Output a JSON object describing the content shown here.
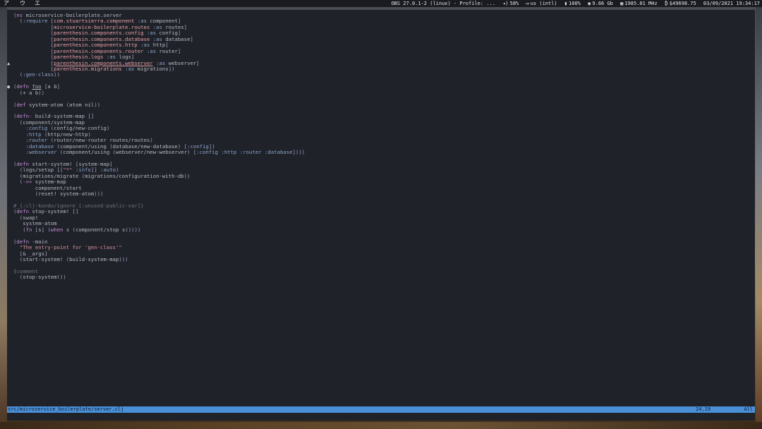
{
  "topbar": {
    "workspaces": [
      "ア",
      "ウ",
      "エ"
    ],
    "status": {
      "obs": "OBS 27.0.1-2 (linux) - Profile: ...",
      "volume": "58%",
      "keyboard": "us (intl)",
      "battery": "100%",
      "memory": "9.66 Gb",
      "cpu": "1985.01 MHz",
      "price": "$49698.75",
      "datetime": "03/09/2021 19:34:17"
    }
  },
  "editor": {
    "lines": [
      "(ns microservice-boilerplate.server",
      "  (:require [com.stuartsierra.component :as component]",
      "            [microservice-boilerplate.routes :as routes]",
      "            [parenthesin.components.config :as config]",
      "            [parenthesin.components.database :as database]",
      "            [parenthesin.components.http :as http]",
      "            [parenthesin.components.router :as router]",
      "            [parenthesin.logs :as logs]",
      "            [parenthesin.components.webserver :as webserver]",
      "            [parenthesin.migrations :as migrations])",
      "  (:gen-class))",
      "",
      "(defn foo [a b]",
      "  (+ a b))",
      "",
      "(def system-atom (atom nil))",
      "",
      "(defn- build-system-map []",
      "  (component/system-map",
      "    :config (config/new-config)",
      "    :http (http/new-http)",
      "    :router (router/new-router routes/routes)",
      "    :database (component/using (database/new-database) [:config])",
      "    :webserver (component/using (webserver/new-webserver) [:config :http :router :database])))",
      "",
      "(defn start-system! [system-map]",
      "  (logs/setup [[\"*\" :info]] :auto)",
      "  (migrations/migrate (migrations/configuration-with-db))",
      "  (->> system-map",
      "       component/start",
      "       (reset! system-atom)))",
      "",
      "#_{:clj-kondo/ignore [:unused-public-var]}",
      "(defn stop-system! []",
      "  (swap!",
      "   system-atom",
      "   (fn [s] (when s (component/stop s)))))",
      "",
      "(defn -main",
      "  \"The entry-point for 'gen-class'\"",
      "  [& _args]",
      "  (start-system! (build-system-map)))",
      "",
      "(comment",
      "  (stop-system!))"
    ],
    "gutter_marks": {
      "warn_line": "▲",
      "info_line": "●"
    }
  },
  "statusline": {
    "path": "src/microservice_boilerplate/server.clj",
    "position": "24,19",
    "scroll": "All"
  }
}
